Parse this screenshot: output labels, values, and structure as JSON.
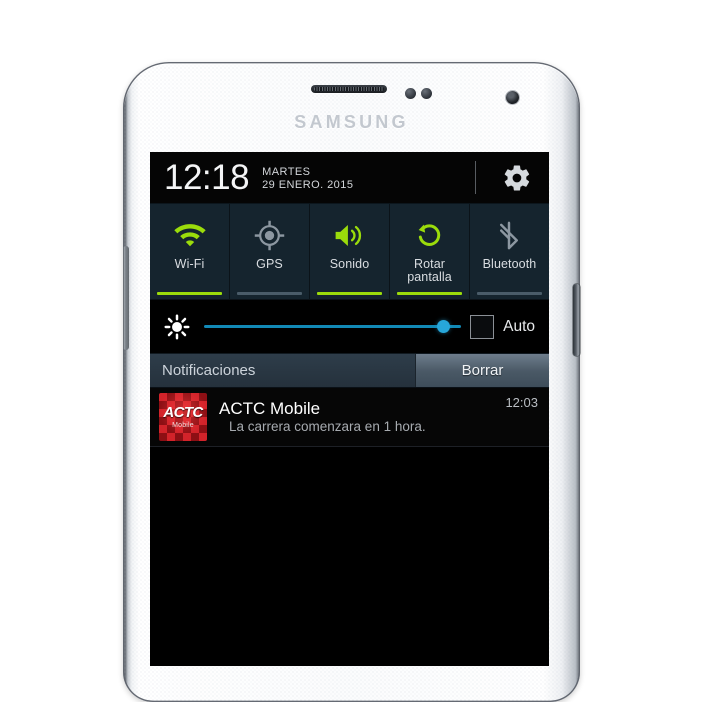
{
  "device": {
    "brand": "SAMSUNG",
    "icons": {
      "earpiece": "earpiece-speaker",
      "front_camera": "front-camera",
      "proximity_sensor": "proximity-sensor",
      "power_button": "power-button",
      "volume_button": "volume-rocker"
    }
  },
  "statusbar": {
    "time": "12:18",
    "day": "MARTES",
    "date": "29 ENERO. 2015",
    "settings_icon": "gear-icon"
  },
  "quick_toggles": [
    {
      "label": "Wi-Fi",
      "icon": "wifi-icon",
      "state": "on",
      "color": "#9bdc0b"
    },
    {
      "label": "GPS",
      "icon": "gps-icon",
      "state": "off",
      "color": "#8c97a1"
    },
    {
      "label": "Sonido",
      "icon": "sound-icon",
      "state": "on",
      "color": "#9bdc0b"
    },
    {
      "label": "Rotar\npantalla",
      "icon": "rotate-icon",
      "state": "on",
      "color": "#9bdc0b"
    },
    {
      "label": "Bluetooth",
      "icon": "bluetooth-icon",
      "state": "off",
      "color": "#8c97a1"
    }
  ],
  "toggle_labels": {
    "wifi": "Wi-Fi",
    "gps": "GPS",
    "sound": "Sonido",
    "rotate_line1": "Rotar",
    "rotate_line2": "pantalla",
    "bluetooth": "Bluetooth"
  },
  "brightness": {
    "icon": "brightness-icon",
    "value_percent": 93,
    "slider_color": "#1289b6",
    "knob_color": "#27a6d9",
    "auto_label": "Auto",
    "auto_checked": false
  },
  "notifications_panel": {
    "title": "Notificaciones",
    "clear_label": "Borrar",
    "items": [
      {
        "app": "ACTC Mobile",
        "icon": "actc-mobile-app-icon",
        "icon_text": "ACTC",
        "icon_subtext": "Mobile",
        "message": "La carrera comenzara en 1 hora.",
        "time": "12:03"
      }
    ]
  },
  "theme": {
    "panel_bg": "#15242e",
    "screen_bg": "#000000",
    "accent_green": "#9bdc0b",
    "accent_blue": "#27a6d9",
    "header_bg": "#2e3d4a"
  }
}
